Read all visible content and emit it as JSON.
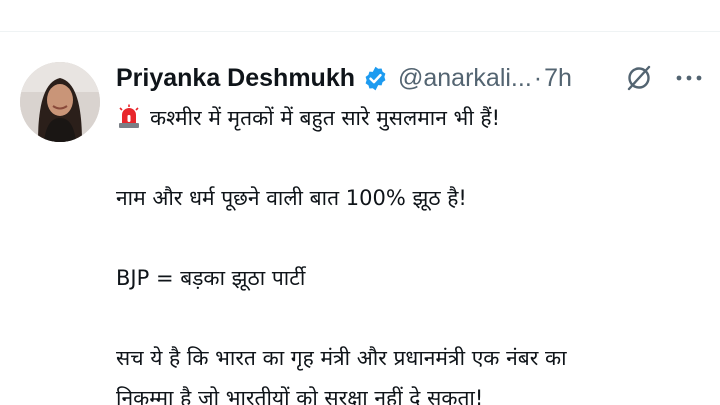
{
  "tweet": {
    "author": {
      "display_name": "Priyanka Deshmukh",
      "handle": "@anarkali...",
      "verified": true,
      "avatar_icon": "profile-photo"
    },
    "separator": "·",
    "time": "7h",
    "icons": {
      "grok": "grok-icon",
      "more": "more-icon",
      "siren": "police-siren-emoji"
    },
    "text": {
      "line_1": "कश्मीर में मृतकों में बहुत सारे मुसलमान भी हैं!",
      "line_2": "नाम और धर्म पूछने वाली बात 100% झूठ है!",
      "line_3": "BJP = बड़का झूठा पार्टी",
      "line_4a": "सच ये है कि भारत का गृह मंत्री और प्रधानमंत्री एक नंबर का",
      "line_4b": "निकम्मा है जो भारतीयों को सुरक्षा नहीं दे सकता!"
    },
    "colors": {
      "verified_badge": "#1d9bf0",
      "secondary_text": "#536471",
      "primary_text": "#0f1419",
      "siren_red": "#e8262b"
    }
  }
}
